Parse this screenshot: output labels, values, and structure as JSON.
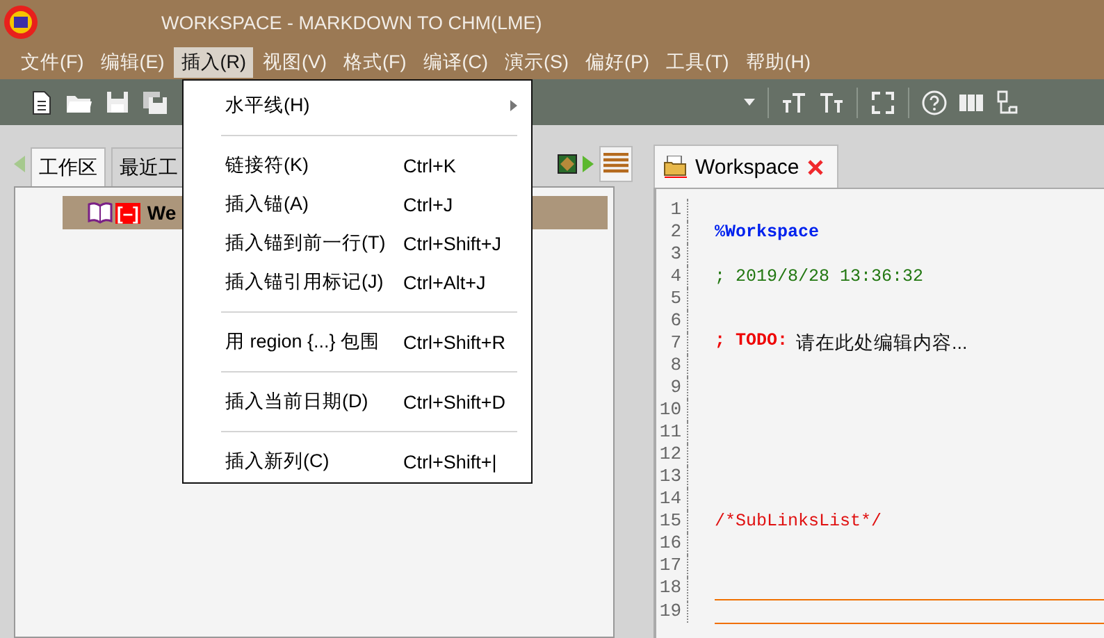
{
  "window": {
    "title": "WORKSPACE - MARKDOWN TO CHM(LME)"
  },
  "menu_bar": [
    {
      "label": "文件(F)",
      "selected": false
    },
    {
      "label": "编辑(E)",
      "selected": false
    },
    {
      "label": "插入(R)",
      "selected": true
    },
    {
      "label": "视图(V)",
      "selected": false
    },
    {
      "label": "格式(F)",
      "selected": false
    },
    {
      "label": "编译(C)",
      "selected": false
    },
    {
      "label": "演示(S)",
      "selected": false
    },
    {
      "label": "偏好(P)",
      "selected": false
    },
    {
      "label": "工具(T)",
      "selected": false
    },
    {
      "label": "帮助(H)",
      "selected": false
    }
  ],
  "insert_menu": {
    "sections": [
      {
        "items": [
          {
            "label": "水平线(H)",
            "kind": "submenu"
          }
        ]
      },
      {
        "items": [
          {
            "label": "链接符(K)",
            "shortcut": "Ctrl+K",
            "kind": "command"
          },
          {
            "label": "插入锚(A)",
            "shortcut": "Ctrl+J",
            "kind": "command"
          },
          {
            "label": "插入锚到前一行(T)",
            "shortcut": "Ctrl+Shift+J",
            "kind": "command"
          },
          {
            "label": "插入锚引用标记(J)",
            "shortcut": "Ctrl+Alt+J",
            "kind": "command"
          }
        ]
      },
      {
        "items": [
          {
            "label": "用 region {...} 包围",
            "shortcut": "Ctrl+Shift+R",
            "kind": "command"
          }
        ]
      },
      {
        "items": [
          {
            "label": "插入当前日期(D)",
            "shortcut": "Ctrl+Shift+D",
            "kind": "command"
          }
        ]
      },
      {
        "items": [
          {
            "label": "插入新列(C)",
            "shortcut": "Ctrl+Shift+|",
            "kind": "command"
          }
        ]
      }
    ]
  },
  "left_panel": {
    "tabs": [
      {
        "label": "工作区",
        "selected": true
      },
      {
        "label": "最近工",
        "selected": false
      }
    ],
    "tree": [
      {
        "toggle": "[–]",
        "label": "We",
        "selected": true
      }
    ]
  },
  "editor": {
    "tab": {
      "label": "Workspace",
      "selected": true
    },
    "lines": [
      {
        "number": "1",
        "kind": "blank"
      },
      {
        "number": "2",
        "kind": "heading",
        "text": "%Workspace"
      },
      {
        "number": "3",
        "kind": "blank"
      },
      {
        "number": "4",
        "kind": "comment",
        "text": "; 2019/8/28 13:36:32"
      },
      {
        "number": "5",
        "kind": "blank"
      },
      {
        "number": "6",
        "kind": "blank"
      },
      {
        "number": "7",
        "kind": "todo",
        "marker": "; TODO:",
        "text": "请在此处编辑内容..."
      },
      {
        "number": "8",
        "kind": "blank"
      },
      {
        "number": "9",
        "kind": "blank"
      },
      {
        "number": "10",
        "kind": "blank"
      },
      {
        "number": "11",
        "kind": "blank"
      },
      {
        "number": "12",
        "kind": "blank"
      },
      {
        "number": "13",
        "kind": "blank"
      },
      {
        "number": "14",
        "kind": "blank"
      },
      {
        "number": "15",
        "kind": "directive",
        "text": "/*SubLinksList*/"
      },
      {
        "number": "16",
        "kind": "blank"
      },
      {
        "number": "17",
        "kind": "blank"
      },
      {
        "number": "18",
        "kind": "blank"
      },
      {
        "number": "19",
        "kind": "band"
      }
    ]
  }
}
